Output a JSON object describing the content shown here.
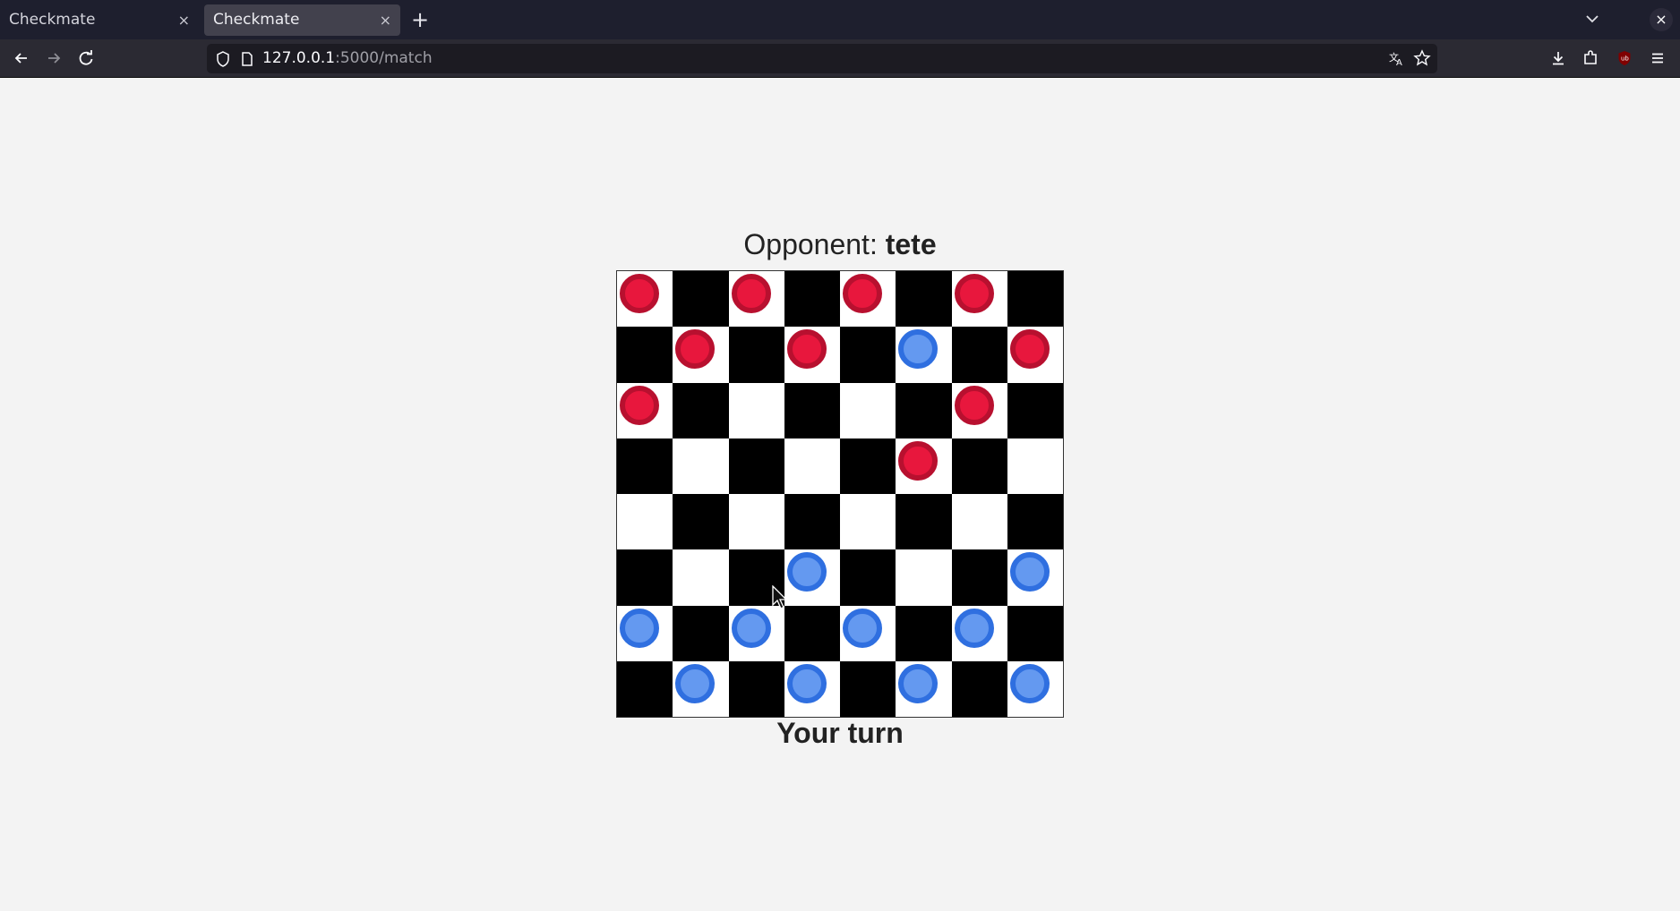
{
  "browser": {
    "tabs": [
      {
        "title": "Checkmate",
        "close": "×",
        "active": false
      },
      {
        "title": "Checkmate",
        "close": "×",
        "active": true
      }
    ],
    "new_tab": "+",
    "close_window": "×",
    "url": {
      "host": "127.0.0.1",
      "path": ":5000/match"
    }
  },
  "page": {
    "opponent_label": "Opponent: ",
    "opponent_name": "tete",
    "status": "Your turn"
  },
  "board": {
    "rows": [
      [
        "red",
        "",
        "red",
        "",
        "red",
        "",
        "red",
        ""
      ],
      [
        "",
        "red",
        "",
        "red",
        "",
        "blue",
        "",
        "red"
      ],
      [
        "red",
        "",
        "",
        "",
        "",
        "",
        "red",
        ""
      ],
      [
        "",
        "",
        "",
        "",
        "",
        "red",
        "",
        ""
      ],
      [
        "",
        "",
        "",
        "",
        "",
        "",
        "",
        ""
      ],
      [
        "",
        "",
        "",
        "blue",
        "",
        "",
        "",
        "blue"
      ],
      [
        "blue",
        "",
        "blue",
        "",
        "blue",
        "",
        "blue",
        ""
      ],
      [
        "",
        "blue",
        "",
        "blue",
        "",
        "blue",
        "",
        "blue"
      ]
    ],
    "colors": {
      "light": "#ffffff",
      "dark": "#000000",
      "red": "#e8173d",
      "blue": "#6499f0"
    }
  }
}
